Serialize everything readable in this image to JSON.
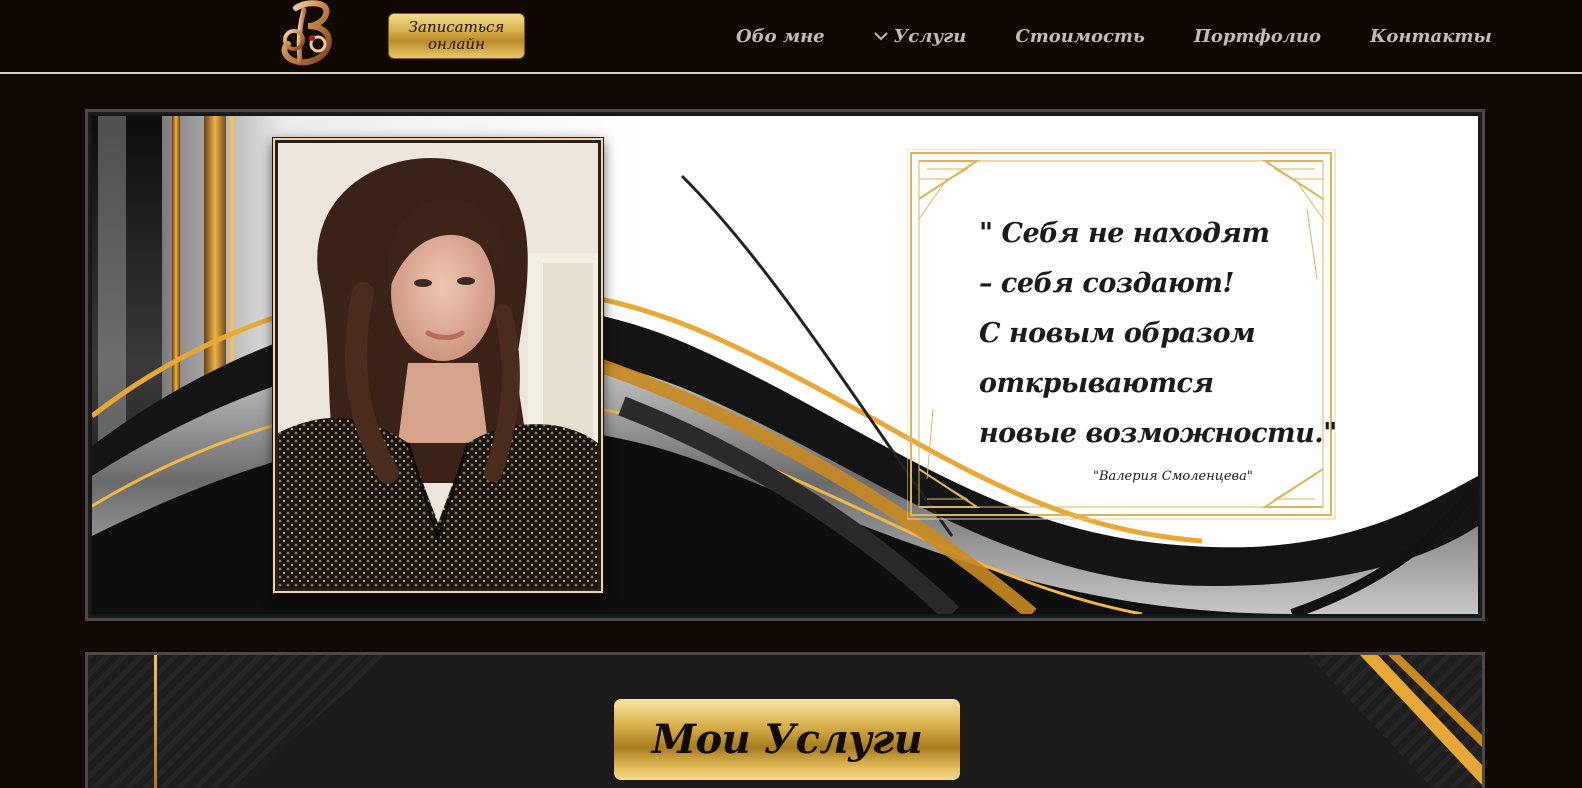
{
  "header": {
    "logo_icon": "monogram-v-logo-icon",
    "cta_label": "Записаться онлайн",
    "nav": [
      {
        "label": "Обо мне",
        "has_dropdown": false
      },
      {
        "label": "Услуги",
        "has_dropdown": true,
        "icon": "chevron-down-icon"
      },
      {
        "label": "Стоимость",
        "has_dropdown": false
      },
      {
        "label": "Портфолио",
        "has_dropdown": false
      },
      {
        "label": "Контакты",
        "has_dropdown": false
      }
    ]
  },
  "hero": {
    "quote_lines": [
      "\" Себя не находят",
      "– себя создают!",
      "С новым образом",
      "открываются",
      "новые возможности.\""
    ],
    "quote_author": "\"Валерия Смоленцева\""
  },
  "services": {
    "title": "Мои Услуги"
  },
  "colors": {
    "background": "#120804",
    "gold": "#d6ae49",
    "nav_text": "#c4bcb4"
  }
}
